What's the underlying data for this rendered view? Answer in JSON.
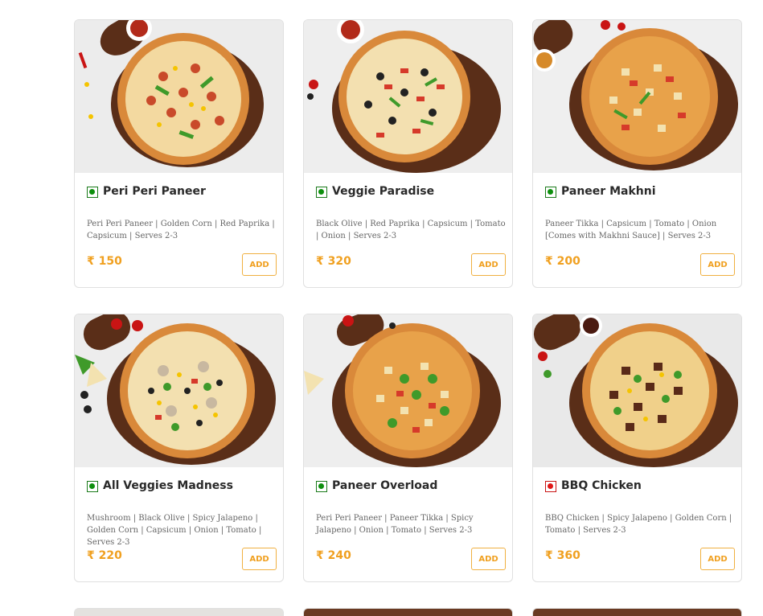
{
  "currency_symbol": "₹",
  "add_label": "ADD",
  "items": [
    {
      "name": "Peri Peri Paneer",
      "type": "veg",
      "desc": "Peri Peri Paneer | Golden Corn | Red Paprika | Capsicum | Serves 2-3",
      "price": "₹ 150",
      "bg": "#ececec"
    },
    {
      "name": "Veggie Paradise",
      "type": "veg",
      "desc": "Black Olive | Red Paprika | Capsicum | Tomato | Onion | Serves 2-3",
      "price": "₹ 320",
      "bg": "#eeeeee"
    },
    {
      "name": "Paneer Makhni",
      "type": "veg",
      "desc": "Paneer Tikka | Capsicum | Tomato | Onion [Comes with Makhni Sauce] | Serves 2-3",
      "price": "₹ 200",
      "bg": "#efefef"
    },
    {
      "name": "All Veggies Madness",
      "type": "veg",
      "desc": "Mushroom | Black Olive | Spicy Jalapeno | Golden Corn | Capsicum | Onion | Tomato | Serves 2-3",
      "price": "₹ 220",
      "bg": "#ededed"
    },
    {
      "name": "Paneer Overload",
      "type": "veg",
      "desc": "Peri Peri Paneer | Paneer Tikka | Spicy Jalapeno | Onion | Tomato | Serves 2-3",
      "price": "₹ 240",
      "bg": "#eeeeee"
    },
    {
      "name": "BBQ Chicken",
      "type": "nonveg",
      "desc": "BBQ Chicken | Spicy Jalapeno | Golden Corn | Tomato | Serves 2-3",
      "price": "₹ 360",
      "bg": "#e9e9e9"
    }
  ],
  "colors": {
    "accent": "#f0a020",
    "veg": "#0d8f0d",
    "nonveg": "#e01616",
    "board": "#5a2e18",
    "crust": "#d9893a",
    "cheese": "#f3d9a0"
  }
}
